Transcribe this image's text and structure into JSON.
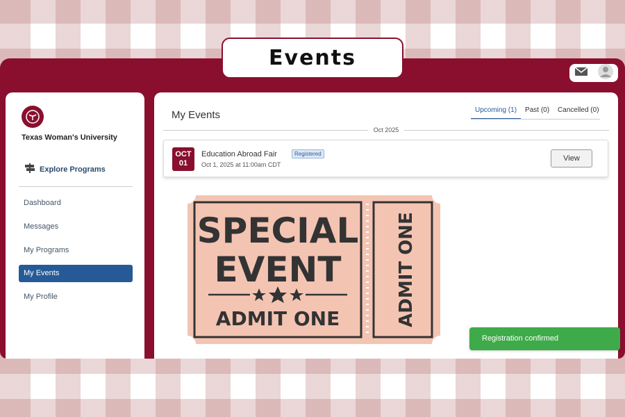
{
  "banner": {
    "title": "Events"
  },
  "sidebar": {
    "org_name": "Texas Woman's University",
    "explore_label": "Explore Programs",
    "items": [
      {
        "label": "Dashboard"
      },
      {
        "label": "Messages"
      },
      {
        "label": "My Programs"
      },
      {
        "label": "My Events",
        "active": true
      },
      {
        "label": "My Profile"
      }
    ]
  },
  "main": {
    "title": "My Events",
    "tabs": [
      {
        "label": "Upcoming (1)",
        "active": true
      },
      {
        "label": "Past (0)"
      },
      {
        "label": "Cancelled (0)"
      }
    ],
    "month_label": "Oct 2025",
    "events": [
      {
        "month": "OCT",
        "day": "01",
        "name": "Education Abroad Fair",
        "badge": "Registered",
        "datetime": "Oct 1, 2025 at 11:00am CDT",
        "button": "View"
      }
    ]
  },
  "ticket": {
    "line1": "SPECIAL",
    "line2": "EVENT",
    "line3": "ADMIT ONE",
    "stub": "ADMIT ONE"
  },
  "toast": {
    "text": "Registration confirmed"
  },
  "icons": {
    "mail": "mail-icon",
    "user": "user-avatar-icon",
    "logo": "university-logo-icon",
    "explore": "signpost-icon"
  },
  "colors": {
    "brand": "#8a0f2f",
    "accent": "#255a97",
    "success": "#3faa4a",
    "ticket": "#f4c4b3"
  }
}
